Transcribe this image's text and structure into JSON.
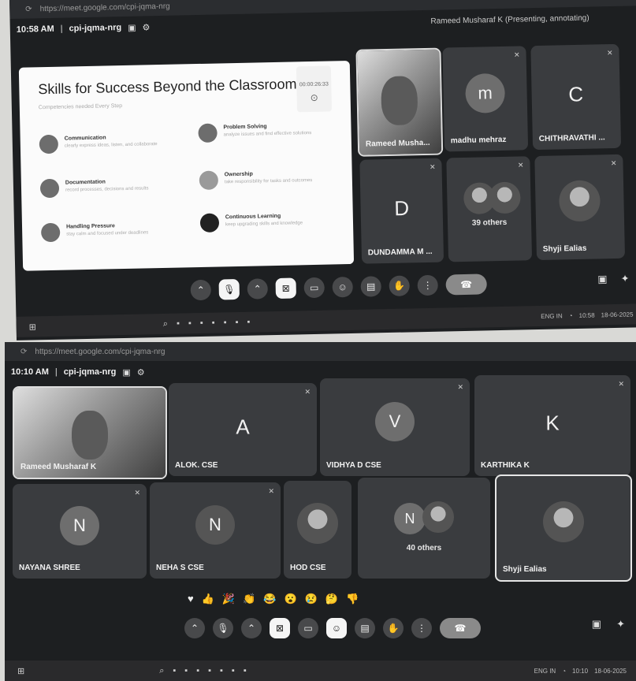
{
  "shot1": {
    "url": "https://meet.google.com/cpi-jqma-nrg",
    "time": "10:58 AM",
    "meeting_code": "cpi-jqma-nrg",
    "presenting": "Rameed Musharaf K (Presenting, annotating)",
    "slide": {
      "title": "Skills for Success Beyond the Classroom",
      "subtitle": "Competencies needed Every Step",
      "clock": "00:00:26:33",
      "skills": [
        {
          "name": "Communication",
          "desc": "clearly express ideas, listen, and collaborate"
        },
        {
          "name": "Problem Solving",
          "desc": "analyze issues and find effective solutions"
        },
        {
          "name": "Documentation",
          "desc": "record processes, decisions and results"
        },
        {
          "name": "Ownership",
          "desc": "take responsibility for tasks and outcomes"
        },
        {
          "name": "Handling Pressure",
          "desc": "stay calm and focused under deadlines"
        },
        {
          "name": "Continuous Learning",
          "desc": "keep upgrading skills and knowledge"
        }
      ]
    },
    "tiles": [
      {
        "name": "Rameed Musha...",
        "kind": "camera"
      },
      {
        "name": "madhu mehraz",
        "letter": "m"
      },
      {
        "name": "CHITHRAVATHI ...",
        "letter": "C"
      },
      {
        "name": "DUNDAMMA M ...",
        "letter": "D"
      },
      {
        "name": "39 others",
        "kind": "group"
      },
      {
        "name": "Shyji Ealias",
        "kind": "photo"
      }
    ],
    "taskbar": {
      "lang": "ENG IN",
      "clock_time": "10:58",
      "clock_date": "18-06-2025"
    }
  },
  "shot2": {
    "url": "https://meet.google.com/cpi-jqma-nrg",
    "time": "10:10 AM",
    "meeting_code": "cpi-jqma-nrg",
    "tiles": [
      {
        "name": "Rameed Musharaf K",
        "kind": "camera"
      },
      {
        "name": "ALOK. CSE",
        "letter": "A"
      },
      {
        "name": "VIDHYA D CSE",
        "letter": "V"
      },
      {
        "name": "KARTHIKA K",
        "letter": "K"
      },
      {
        "name": "NAYANA SHREE",
        "letter": "N"
      },
      {
        "name": "NEHA S CSE",
        "letter": "N"
      },
      {
        "name": "HOD CSE",
        "kind": "photo"
      },
      {
        "name": "40 others",
        "kind": "group",
        "letter": "N"
      },
      {
        "name": "Shyji Ealias",
        "kind": "photo"
      }
    ],
    "reactions": [
      "♥",
      "👍",
      "🎉",
      "👏",
      "😂",
      "😮",
      "😢",
      "🤔",
      "👎"
    ],
    "taskbar": {
      "lang": "ENG IN",
      "clock_time": "10:10",
      "clock_date": "18-06-2025"
    }
  }
}
